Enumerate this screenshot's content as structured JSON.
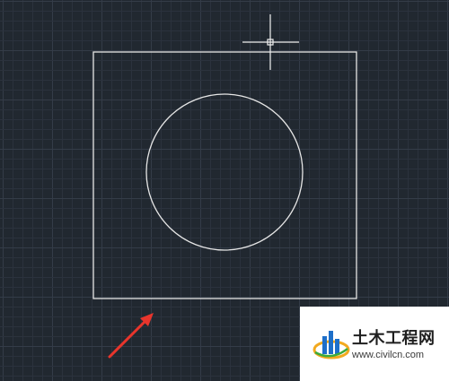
{
  "canvas": {
    "background_color": "#212830",
    "grid_minor_color": "#2b323d",
    "grid_major_color": "#343c48",
    "geometry_color": "#e6e6e6"
  },
  "drawing": {
    "entities": [
      {
        "type": "rectangle",
        "name": "square"
      },
      {
        "type": "circle",
        "name": "circle"
      }
    ]
  },
  "cursor": {
    "icon": "crosshair-cursor-icon"
  },
  "annotation": {
    "icon": "red-arrow-icon",
    "color": "#e8352c"
  },
  "watermark": {
    "title": "土木工程网",
    "url": "www.civilcn.com",
    "logo_icon": "civilcn-logo-icon",
    "logo_colors": [
      "#1e6fc9",
      "#f2a91f",
      "#3cab3c"
    ]
  }
}
